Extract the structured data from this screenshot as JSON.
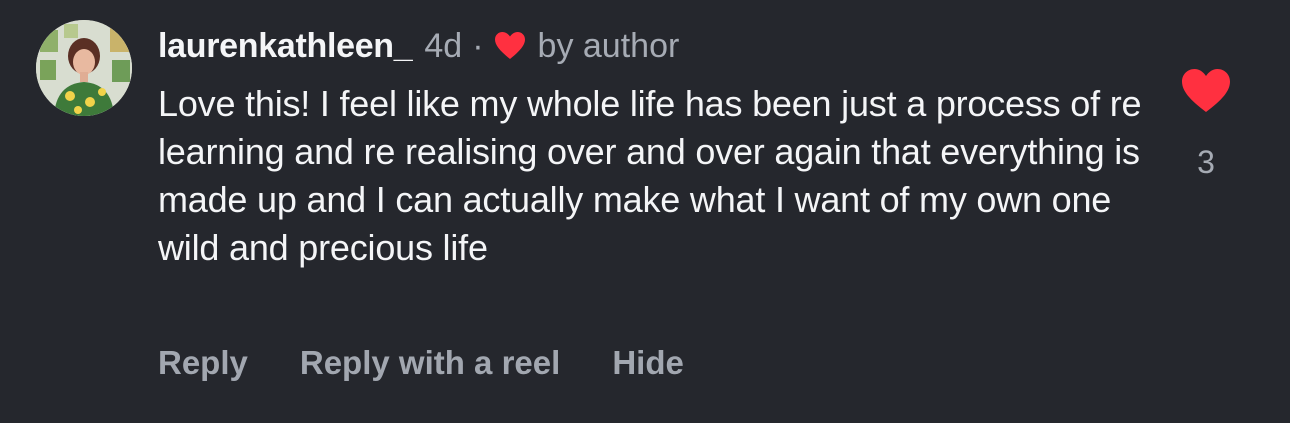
{
  "comment": {
    "username": "laurenkathleen_",
    "time": "4d",
    "separator": "·",
    "author_badge": "by author",
    "text": "Love this! I feel like my whole life has been just a process of re learning and re realising over and over again that everything is made up and I can actually make what I want of my own one wild and precious life",
    "like_count": "3"
  },
  "actions": {
    "reply": "Reply",
    "reply_reel": "Reply with a reel",
    "hide": "Hide"
  },
  "icons": {
    "author_heart": "heart-icon",
    "like": "heart-icon"
  },
  "colors": {
    "background": "#25272d",
    "text": "#f4f5f7",
    "muted": "#a6abb4",
    "heart": "#ff3040"
  }
}
